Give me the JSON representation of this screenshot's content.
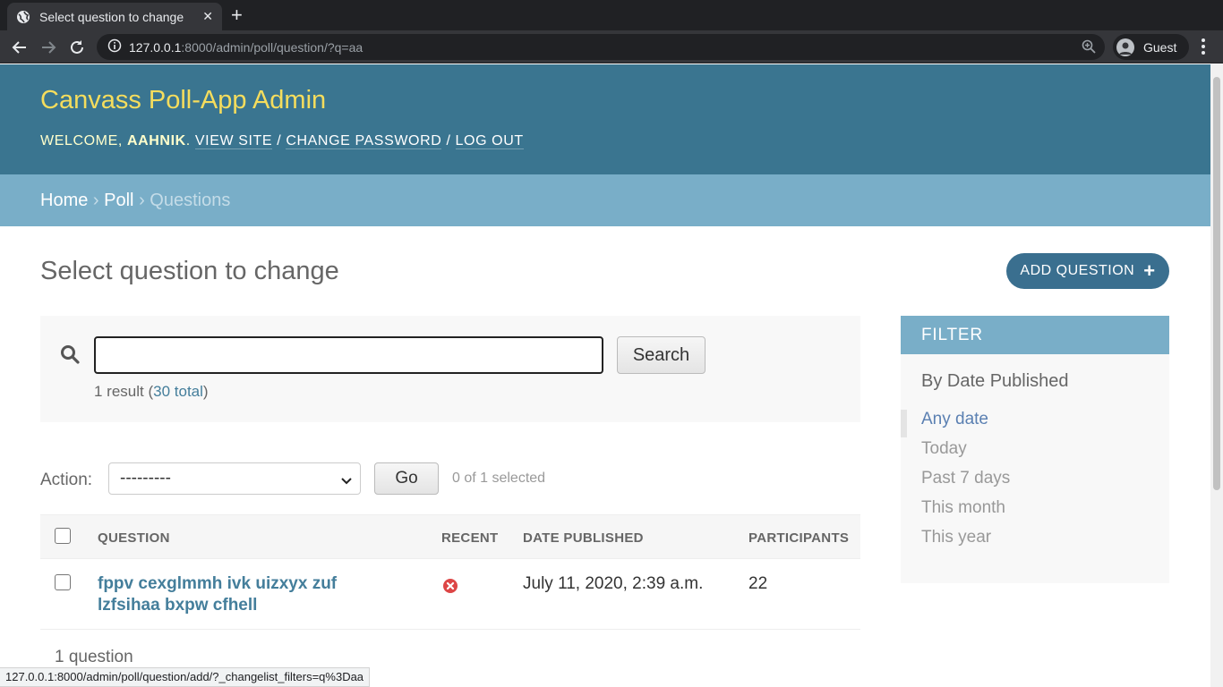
{
  "browser": {
    "tab_title": "Select question to change",
    "url_host": "127.0.0.1",
    "url_path": ":8000/admin/poll/question/?q=aa",
    "profile_label": "Guest"
  },
  "admin": {
    "site_name": "Canvass Poll-App Admin",
    "user_tools": {
      "welcome": "WELCOME,",
      "username": "AAHNIK",
      "view_site": "VIEW SITE",
      "change_password": "CHANGE PASSWORD",
      "log_out": "LOG OUT"
    },
    "breadcrumbs": {
      "home": "Home",
      "app": "Poll",
      "current": "Questions"
    },
    "page_title": "Select question to change",
    "add_button": "ADD QUESTION",
    "search": {
      "value": "",
      "button": "Search",
      "result_prefix": "1 result (",
      "total_link": "30 total",
      "result_suffix": ")"
    },
    "actions": {
      "label": "Action:",
      "selected_option": "---------",
      "go_button": "Go",
      "selected_count": "0 of 1 selected"
    },
    "table": {
      "columns": [
        "QUESTION",
        "RECENT",
        "DATE PUBLISHED",
        "PARTICIPANTS"
      ],
      "rows": [
        {
          "question": "fppv cexglmmh ivk uizxyx zuf lzfsihaa bxpw cfhell",
          "recent": false,
          "date_published": "July 11, 2020, 2:39 a.m.",
          "participants": "22"
        }
      ]
    },
    "paginator": "1 question",
    "filter": {
      "title": "FILTER",
      "subtitle": "By Date Published",
      "options": [
        "Any date",
        "Today",
        "Past 7 days",
        "This month",
        "This year"
      ],
      "selected": "Any date"
    }
  },
  "statusbar": "127.0.0.1:8000/admin/poll/question/add/?_changelist_filters=q%3Daa",
  "colors": {
    "header_bg": "#3a7590",
    "site_name": "#f5dd5d",
    "breadcrumbs_bg": "#79aec8",
    "link": "#447e9b",
    "recent_false": "#dd4646"
  }
}
